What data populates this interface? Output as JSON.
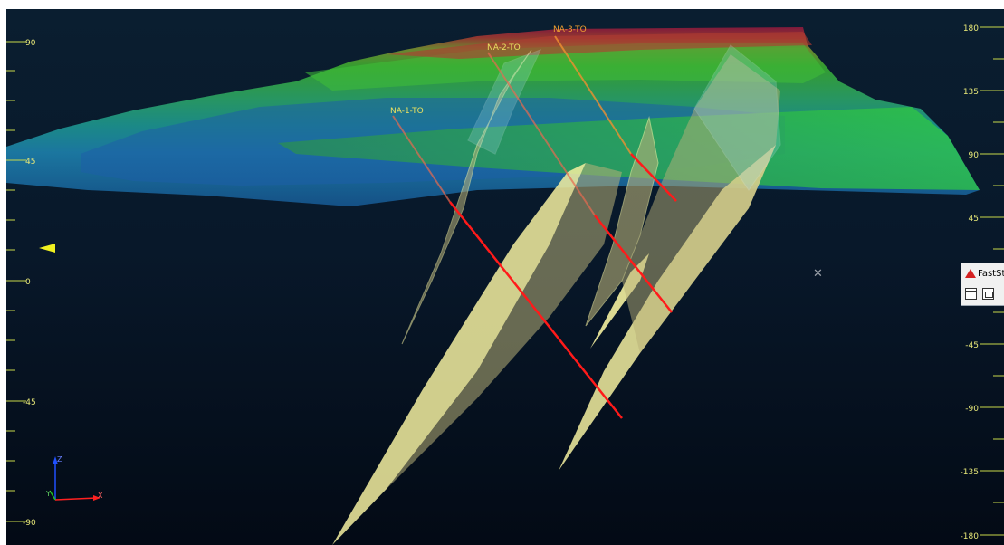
{
  "left_axis": {
    "labels": [
      "90",
      "45",
      "0",
      "-45",
      "-90"
    ]
  },
  "right_axis": {
    "labels": [
      "180",
      "135",
      "90",
      "45",
      "0",
      "-45",
      "-90",
      "-135",
      "-180"
    ]
  },
  "drillholes": [
    {
      "name": "NA-1-TO",
      "color": "#e8e060"
    },
    {
      "name": "NA-2-TO",
      "color": "#e8e060"
    },
    {
      "name": "NA-3-TO",
      "color": "#f0a030"
    }
  ],
  "axes_triad": {
    "z_label": "Z",
    "y_label": "Y",
    "x_label": "X"
  },
  "fast_panel": {
    "title": "FastSt"
  },
  "colors": {
    "background": "#061426",
    "axis_ticks": "#c8d84a",
    "drillhole_trace": "#ff1a1a",
    "vein_fill": "#f4f0a0"
  },
  "icons": [
    "pointer-arrow-icon",
    "cursor-cross-icon",
    "fast-logo-icon",
    "window-restore-icon",
    "window-maximize-icon"
  ]
}
